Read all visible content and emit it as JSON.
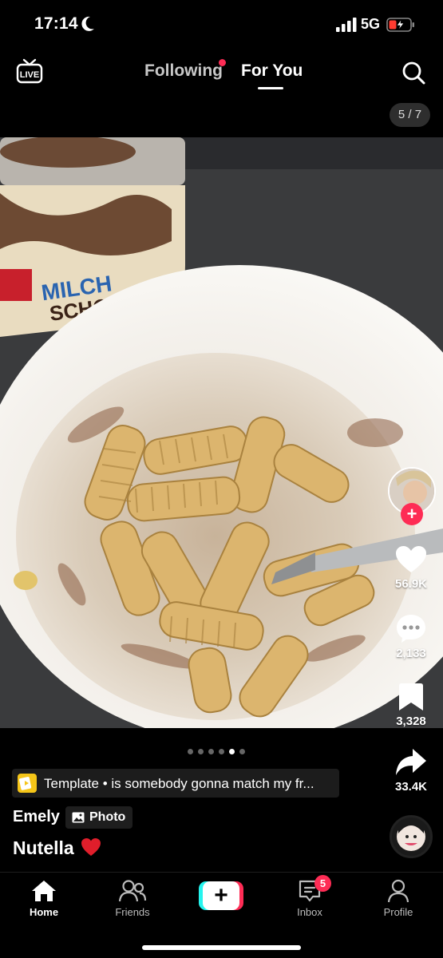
{
  "status_bar": {
    "time": "17:14",
    "network": "5G",
    "icons": [
      "moon-icon",
      "signal-icon",
      "battery-charging-icon"
    ]
  },
  "top_nav": {
    "live_icon": "live-icon",
    "tabs": [
      {
        "label": "Following",
        "has_notification_dot": true
      },
      {
        "label": "For You",
        "active": true
      }
    ],
    "search_icon": "search-icon"
  },
  "photo": {
    "page_counter": "5 / 7",
    "jar_text_line1": "MILCH",
    "jar_text_line2": "SCHOKO",
    "pager": {
      "total": 6,
      "active_index": 4
    }
  },
  "right_rail": {
    "follow_icon": "plus-icon",
    "likes": "56.9K",
    "comments": "2,133",
    "saves": "3,328",
    "shares": "33.4K"
  },
  "caption_area": {
    "template_text": "Template • is somebody gonna match my fr...",
    "author": "Emely",
    "photo_tag": "Photo",
    "caption": "Nutella",
    "caption_emoji": "heart-emoji"
  },
  "bottom_nav": {
    "items": [
      {
        "label": "Home",
        "icon": "home-icon",
        "active": true
      },
      {
        "label": "Friends",
        "icon": "friends-icon"
      },
      {
        "label": "",
        "icon": "create-icon"
      },
      {
        "label": "Inbox",
        "icon": "inbox-icon",
        "badge": "5"
      },
      {
        "label": "Profile",
        "icon": "profile-icon"
      }
    ]
  },
  "colors": {
    "accent_red": "#fe2c55",
    "accent_cyan": "#25f4ee",
    "background": "#000000"
  }
}
